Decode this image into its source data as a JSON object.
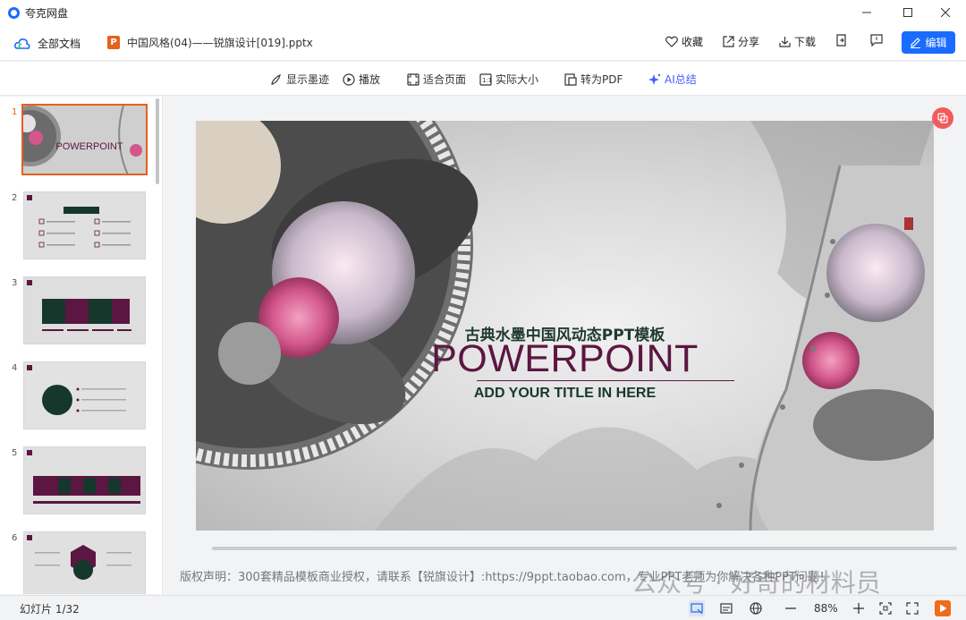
{
  "window": {
    "title": "夸克网盘"
  },
  "header": {
    "all_docs": "全部文档",
    "file_icon_letter": "P",
    "file_name": "中国风格(04)——锐旗设计[019].pptx",
    "favorite": "收藏",
    "share": "分享",
    "download": "下载",
    "edit": "编辑"
  },
  "toolbar": {
    "show_ink": "显示墨迹",
    "play": "播放",
    "fit_page": "适合页面",
    "actual_size": "实际大小",
    "to_pdf": "转为PDF",
    "ai_summary": "AI总结"
  },
  "sidebar": {
    "thumbnails": [
      {
        "num": "1",
        "active": true
      },
      {
        "num": "2",
        "active": false
      },
      {
        "num": "3",
        "active": false
      },
      {
        "num": "4",
        "active": false
      },
      {
        "num": "5",
        "active": false
      },
      {
        "num": "6",
        "active": false
      }
    ],
    "thumb1_title": "POWERPOINT"
  },
  "slide": {
    "subtitle": "古典水墨中国风动态PPT模板",
    "title": "POWERPOINT",
    "add_title": "ADD YOUR TITLE IN HERE"
  },
  "copyright": "版权声明：300套精品模板商业授权，请联系【锐旗设计】:https://9ppt.taobao.com，专业PPT老师为你解决各种PPT问题！",
  "status": {
    "slide_counter": "幻灯片 1/32",
    "zoom": "88%"
  },
  "watermark": "公众号 · 好奇的材料员",
  "colors": {
    "accent": "#1a6bff",
    "ppt_orange": "#e3621e",
    "title_purple": "#5c1642"
  }
}
